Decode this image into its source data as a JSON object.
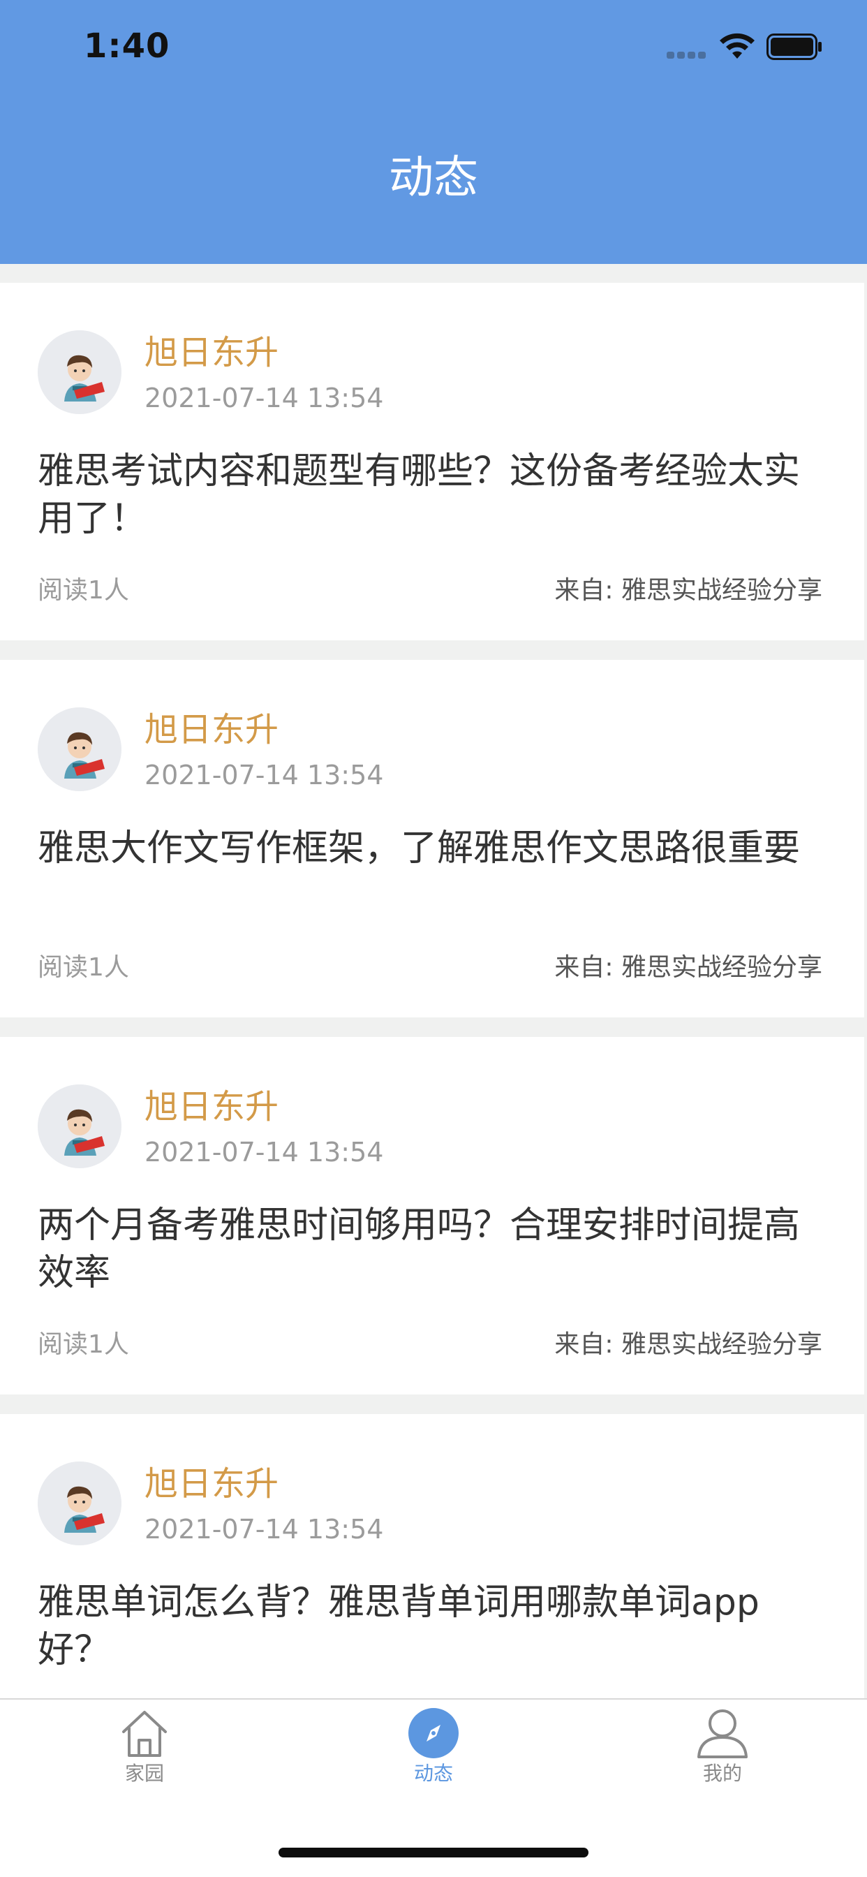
{
  "status_bar": {
    "time": "1:40"
  },
  "header": {
    "title": "动态"
  },
  "posts": [
    {
      "author": "旭日东升",
      "time": "2021-07-14 13:54",
      "title": "雅思考试内容和题型有哪些？这份备考经验太实用了！",
      "reads": "阅读1人",
      "source": "来自: 雅思实战经验分享"
    },
    {
      "author": "旭日东升",
      "time": "2021-07-14 13:54",
      "title": "雅思大作文写作框架，了解雅思作文思路很重要",
      "reads": "阅读1人",
      "source": "来自: 雅思实战经验分享"
    },
    {
      "author": "旭日东升",
      "time": "2021-07-14 13:54",
      "title": "两个月备考雅思时间够用吗？合理安排时间提高效率",
      "reads": "阅读1人",
      "source": "来自: 雅思实战经验分享"
    },
    {
      "author": "旭日东升",
      "time": "2021-07-14 13:54",
      "title": "雅思单词怎么背？雅思背单词用哪款单词app好？",
      "reads": "",
      "source": ""
    }
  ],
  "tabbar": {
    "items": [
      {
        "label": "家园",
        "icon": "home-icon",
        "active": false
      },
      {
        "label": "动态",
        "icon": "compass-icon",
        "active": true
      },
      {
        "label": "我的",
        "icon": "user-icon",
        "active": false
      }
    ]
  },
  "colors": {
    "header_bg": "#6199e3",
    "author": "#d39a48",
    "tab_active": "#5c97e0",
    "tab_inactive": "#8a8a8a",
    "page_bg": "#f0f1f0"
  }
}
